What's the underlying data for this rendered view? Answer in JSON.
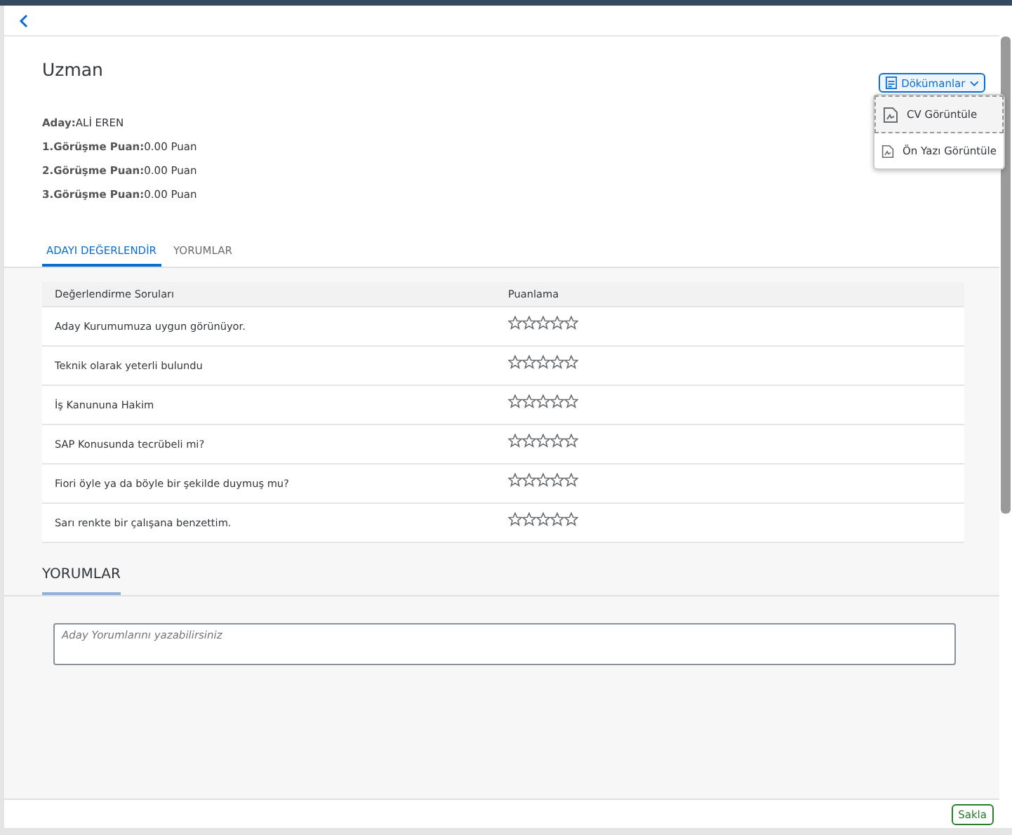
{
  "header": {
    "title": "Uzman",
    "fields": [
      {
        "label": "Aday:",
        "value": "ALİ EREN"
      },
      {
        "label": "1.Görüşme Puan:",
        "value": "0.00 Puan"
      },
      {
        "label": "2.Görüşme Puan:",
        "value": "0.00 Puan"
      },
      {
        "label": "3.Görüşme Puan:",
        "value": "0.00 Puan"
      }
    ]
  },
  "documents_button": {
    "label": "Dökümanlar",
    "expanded": true,
    "menu": [
      {
        "label": "CV Görüntüle",
        "selected": true
      },
      {
        "label": "Ön Yazı Görüntüle",
        "selected": false
      }
    ]
  },
  "tabs": [
    {
      "label": "ADAYI DEĞERLENDİR",
      "selected": true
    },
    {
      "label": "YORUMLAR",
      "selected": false
    }
  ],
  "table": {
    "columns": [
      "Değerlendirme Soruları",
      "Puanlama"
    ],
    "rows": [
      {
        "question": "Aday Kurumumuza uygun görünüyor.",
        "stars": 0
      },
      {
        "question": "Teknik olarak yeterli bulundu",
        "stars": 0
      },
      {
        "question": "İş Kanununa Hakim",
        "stars": 0
      },
      {
        "question": "SAP Konusunda tecrübeli mi?",
        "stars": 0
      },
      {
        "question": "Fiori öyle ya da böyle bir şekilde duymuş mu?",
        "stars": 0
      },
      {
        "question": "Sarı renkte bir çalışana benzettim.",
        "stars": 0
      }
    ]
  },
  "comments": {
    "title": "YORUMLAR",
    "placeholder": "Aday Yorumlarını yazabilirsiniz"
  },
  "footer": {
    "save_button": "Sakla"
  }
}
